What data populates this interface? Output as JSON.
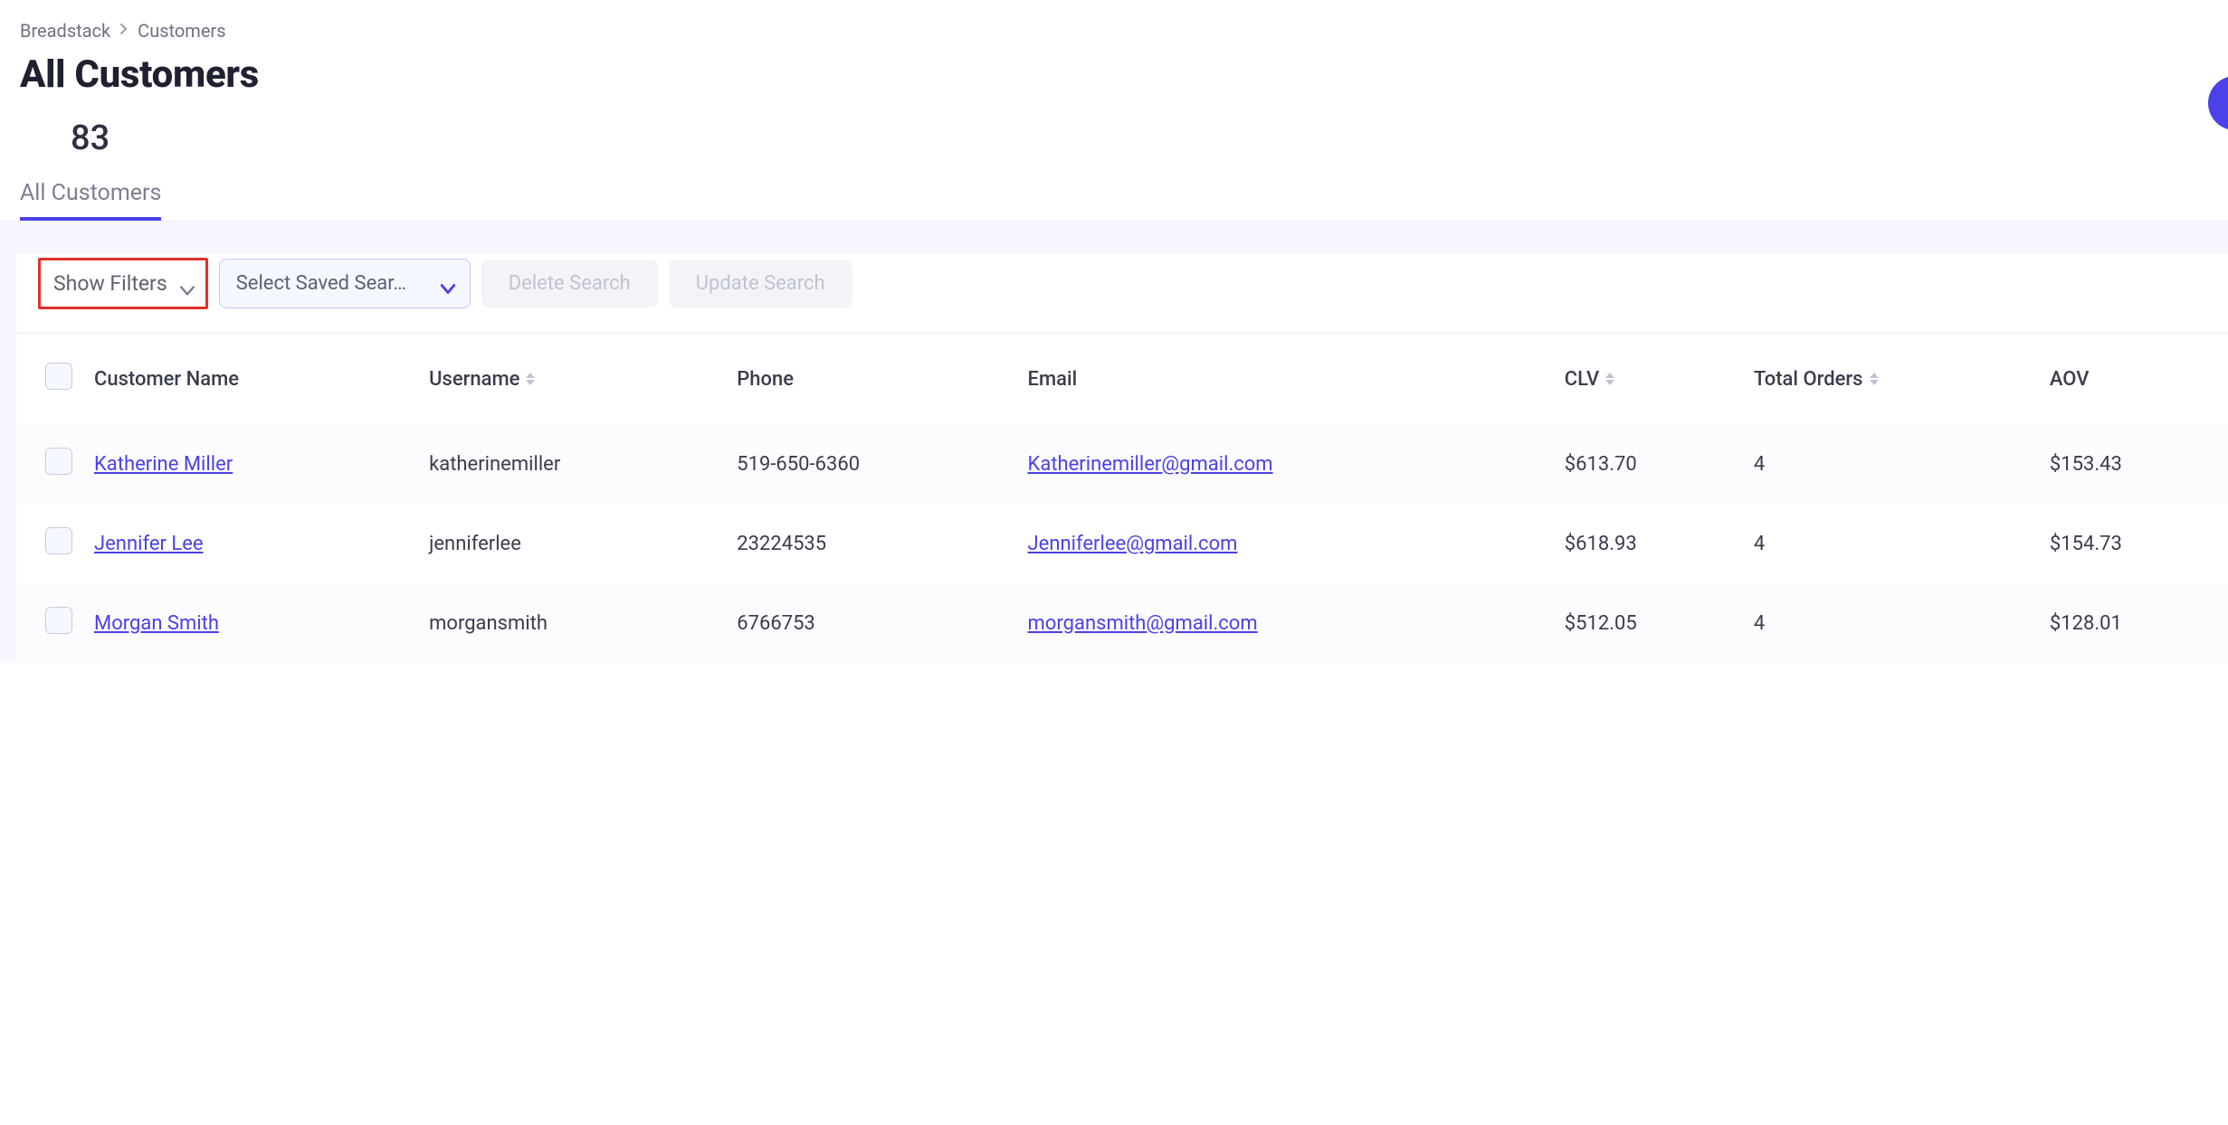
{
  "breadcrumb": {
    "root": "Breadstack",
    "current": "Customers"
  },
  "header": {
    "title": "All Customers",
    "count": "83"
  },
  "tab": {
    "label": "All Customers"
  },
  "controls": {
    "show_filters": "Show Filters",
    "saved_search_placeholder": "Select Saved Sear…",
    "delete_search": "Delete Search",
    "update_search": "Update Search"
  },
  "table": {
    "headers": {
      "name": "Customer Name",
      "username": "Username",
      "phone": "Phone",
      "email": "Email",
      "clv": "CLV",
      "orders": "Total Orders",
      "aov": "AOV"
    },
    "rows": [
      {
        "name": "Katherine Miller",
        "username": "katherinemiller",
        "phone": "519-650-6360",
        "email": "Katherinemiller@gmail.com",
        "clv": "$613.70",
        "orders": "4",
        "aov": "$153.43"
      },
      {
        "name": "Jennifer Lee",
        "username": "jenniferlee",
        "phone": "23224535",
        "email": "Jenniferlee@gmail.com",
        "clv": "$618.93",
        "orders": "4",
        "aov": "$154.73"
      },
      {
        "name": "Morgan Smith",
        "username": "morgansmith",
        "phone": "6766753",
        "email": "morgansmith@gmail.com",
        "clv": "$512.05",
        "orders": "4",
        "aov": "$128.01"
      }
    ]
  }
}
